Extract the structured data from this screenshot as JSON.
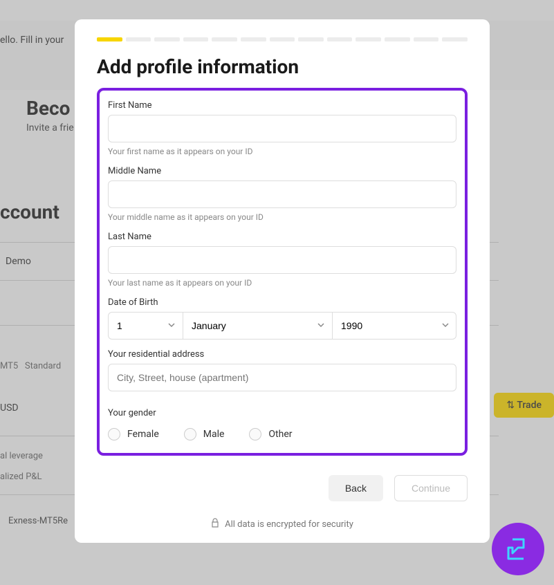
{
  "background": {
    "banner_text": "ello. Fill in your",
    "title": "Beco",
    "subtitle": "Invite a frie",
    "accounts_heading": "ccount",
    "demo_tab": "Demo",
    "tag_mt5": "MT5",
    "tag_standard": "Standard",
    "currency": "USD",
    "trade_btn": "Trade",
    "leverage_label": "al leverage",
    "pnl_label": "alized P&L",
    "server": "Exness-MT5Re"
  },
  "modal": {
    "title": "Add profile information",
    "first_name": {
      "label": "First Name",
      "hint": "Your first name as it appears on your ID"
    },
    "middle_name": {
      "label": "Middle Name",
      "hint": "Your middle name as it appears on your ID"
    },
    "last_name": {
      "label": "Last Name",
      "hint": "Your last name as it appears on your ID"
    },
    "dob": {
      "label": "Date of Birth",
      "day": "1",
      "month": "January",
      "year": "1990"
    },
    "address": {
      "label": "Your residential address",
      "placeholder": "City, Street, house (apartment)"
    },
    "gender": {
      "label": "Your gender",
      "female": "Female",
      "male": "Male",
      "other": "Other"
    },
    "buttons": {
      "back": "Back",
      "continue": "Continue"
    },
    "encryption": "All data is encrypted for security"
  }
}
